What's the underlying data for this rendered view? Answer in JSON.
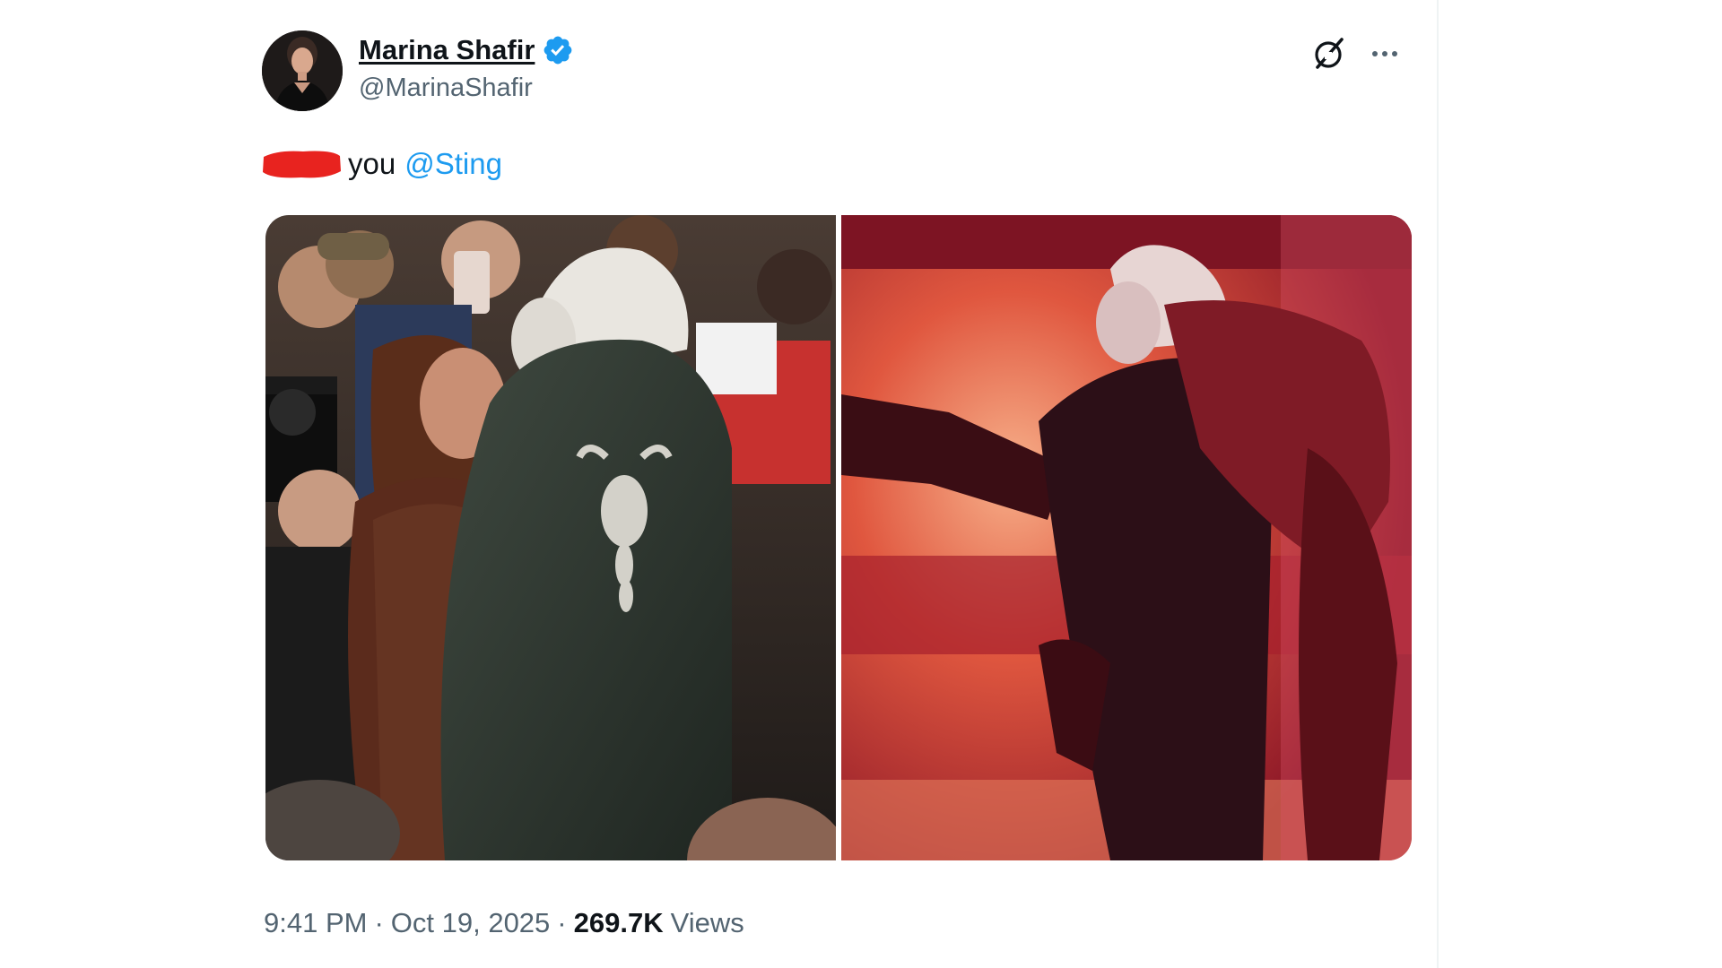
{
  "author": {
    "display_name": "Marina Shafir",
    "handle": "@MarinaShafir",
    "verified": true,
    "verified_color": "#1d9bf0"
  },
  "header_icons": {
    "grok": "grok-icon",
    "more": "more-icon"
  },
  "tweet": {
    "text_visible": "you",
    "mention": "@Sting",
    "redaction_color": "#e8231f",
    "mention_color": "#1d9bf0"
  },
  "media": {
    "count": 2
  },
  "meta": {
    "time": "9:41 PM",
    "separator": "·",
    "date": "Oct 19, 2025",
    "views_count": "269.7K",
    "views_label": "Views"
  }
}
